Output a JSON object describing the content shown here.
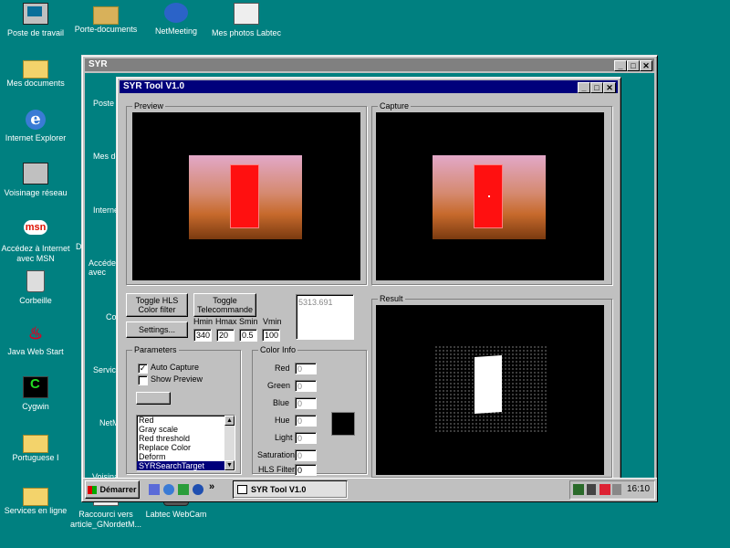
{
  "desktop": {
    "icons_left": [
      {
        "label": "Poste de travail",
        "icon": "computer-icon"
      },
      {
        "label": "Mes documents",
        "icon": "folder-icon"
      },
      {
        "label": "Internet Explorer",
        "icon": "internet-explorer-icon"
      },
      {
        "label": "Voisinage réseau",
        "icon": "network-icon"
      },
      {
        "label": "Accédez à Internet avec MSN",
        "icon": "msn-icon"
      },
      {
        "label": "Corbeille",
        "icon": "recycle-bin-icon"
      },
      {
        "label": "Java Web Start",
        "icon": "java-icon"
      },
      {
        "label": "Cygwin",
        "icon": "cygwin-icon"
      },
      {
        "label": "Portuguese I",
        "icon": "folder-icon"
      },
      {
        "label": "Services en ligne",
        "icon": "folder-icon"
      }
    ],
    "icons_top": [
      {
        "label": "Porte-documents",
        "icon": "briefcase-icon"
      },
      {
        "label": "NetMeeting",
        "icon": "netmeeting-icon"
      },
      {
        "label": "Mes photos Labtec",
        "icon": "photos-icon"
      }
    ],
    "icons_bottom": [
      {
        "label": "Raccourci vers article_GNordetM...",
        "icon": "shortcut-icon"
      },
      {
        "label": "Labtec WebCam",
        "icon": "webcam-icon"
      }
    ],
    "partial_labels": {
      "right_labtec": "abtec"
    }
  },
  "outer_window": {
    "title": "SYR",
    "behind_labels": [
      "Poste",
      "Mes do",
      "Interne",
      "Accéde avec",
      "Cor",
      "Service",
      "NetM",
      "Voisina"
    ],
    "left_partial": [
      "D"
    ]
  },
  "syr_tool": {
    "title": "SYR Tool V1.0",
    "preview_label": "Preview",
    "capture_label": "Capture",
    "result_label": "Result",
    "toggle_hls_label": "Toggle HLS Color filter",
    "toggle_telecommande_label": "Toggle Telecommande",
    "settings_label": "Settings...",
    "readout_value": "5313.691",
    "hls_params": {
      "hmin_label": "Hmin",
      "hmin_value": "340",
      "hmax_label": "Hmax",
      "hmax_value": "20",
      "smin_label": "Smin",
      "smin_value": "0.5",
      "vmin_label": "Vmin",
      "vmin_value": "100"
    },
    "parameters": {
      "label": "Parameters",
      "auto_capture_label": "Auto Capture",
      "auto_capture_checked": true,
      "show_preview_label": "Show Preview",
      "show_preview_checked": false,
      "filters": [
        "Red",
        "Gray scale",
        "Red threshold",
        "Replace Color",
        "Deform",
        "SYRSearchTarget"
      ],
      "selected_filter": "SYRSearchTarget"
    },
    "color_info": {
      "label": "Color Info",
      "red_label": "Red",
      "red_value": "0",
      "green_label": "Green",
      "green_value": "0",
      "blue_label": "Blue",
      "blue_value": "0",
      "hue_label": "Hue",
      "hue_value": "0",
      "light_label": "Light",
      "light_value": "0",
      "saturation_label": "Saturation",
      "saturation_value": "0",
      "hls_filter_label": "HLS Filter",
      "hls_filter_value": "0",
      "swatch_color": "#000000"
    }
  },
  "taskbar": {
    "start_label": "Démarrer",
    "task_label": "SYR Tool V1.0",
    "clock": "16:10",
    "overflow": "»"
  },
  "colors": {
    "desktop": "#008080",
    "title_active": "#00007b",
    "title_inactive": "#808080",
    "face": "#c0c0c0"
  }
}
